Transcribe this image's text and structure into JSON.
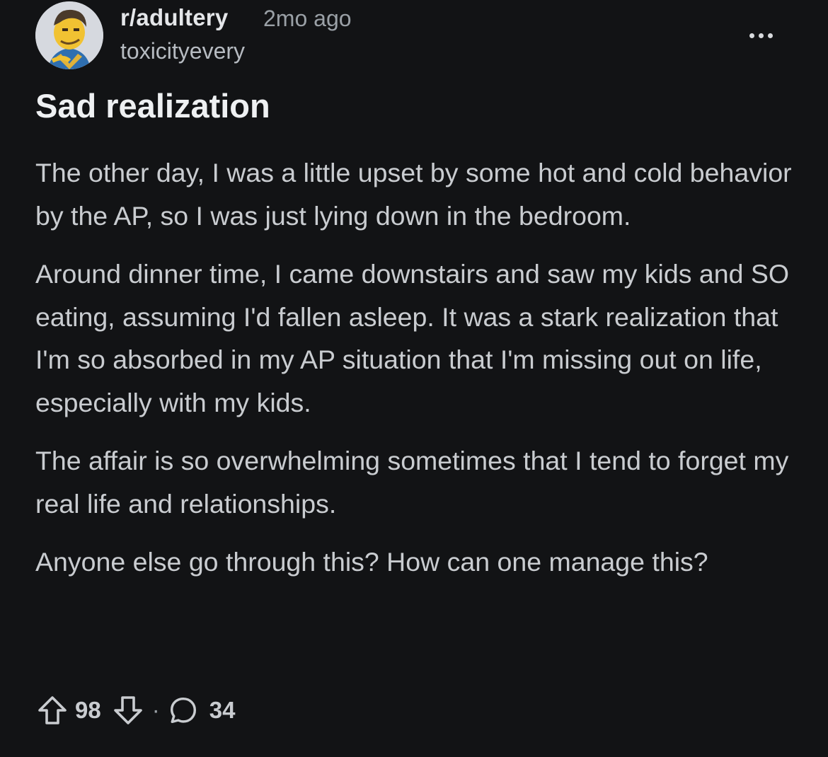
{
  "header": {
    "subreddit": "r/adultery",
    "time": "2mo ago",
    "username": "toxicityevery",
    "avatar_icon": "cartoon-avatar",
    "more_icon": "ellipsis-icon"
  },
  "post": {
    "title": "Sad realization",
    "paragraphs": [
      "The other day, I was a little upset by some hot and cold behavior by the AP, so I was just lying down in the bedroom.",
      "Around dinner time, I came downstairs and saw my kids and SO eating, assuming I'd fallen asleep. It was a stark realization that I'm so absorbed in my AP situation that I'm missing out on life, especially with my kids.",
      "The affair is so overwhelming sometimes that I tend to forget my real life and relationships.",
      "Anyone else go through this? How can one manage this?"
    ]
  },
  "actions": {
    "upvotes": "98",
    "separator": "·",
    "comments": "34",
    "upvote_icon": "upvote-arrow-icon",
    "downvote_icon": "downvote-arrow-icon",
    "comment_icon": "comment-bubble-icon"
  },
  "colors": {
    "background": "#121315",
    "text": "#c9ccd0",
    "muted": "#9aa0a6"
  }
}
